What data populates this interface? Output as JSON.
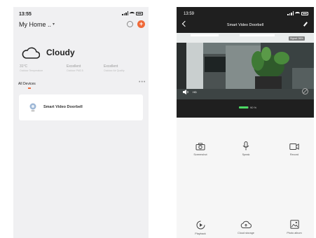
{
  "left": {
    "status": {
      "time": "13:55"
    },
    "home": {
      "title": "My Home ..",
      "caret": "▾",
      "add": "+"
    },
    "weather": {
      "condition": "Cloudy",
      "stats": [
        {
          "value": "31°C",
          "label": "Outdoor Temperature"
        },
        {
          "value": "Excellent",
          "label": "Outdoor PM2.5"
        },
        {
          "value": "Excellent",
          "label": "Outdoor Air Quality"
        }
      ]
    },
    "section": {
      "title": "All Devices",
      "more": "•••"
    },
    "device": {
      "name": "Smart Video Doorbell"
    }
  },
  "right": {
    "status": {
      "time": "13:59"
    },
    "title": "Smart Video Doorbell",
    "signal": "Signal: 96%",
    "quality": "HD",
    "battery": {
      "value": 90,
      "text": "90 %"
    },
    "controls": [
      {
        "label": "Screenshot",
        "icon": "camera-icon"
      },
      {
        "label": "Speak",
        "icon": "microphone-icon"
      },
      {
        "label": "Record",
        "icon": "video-camera-icon"
      },
      {
        "label": "Playback",
        "icon": "playback-icon"
      },
      {
        "label": "Cloud storage",
        "icon": "cloud-upload-icon"
      },
      {
        "label": "Photo album",
        "icon": "photo-album-icon"
      }
    ]
  },
  "colors": {
    "accent": "#ef6a3a",
    "battery": "#4cd964",
    "dark": "#1f1f1f",
    "panel": "#f0f0f2"
  }
}
